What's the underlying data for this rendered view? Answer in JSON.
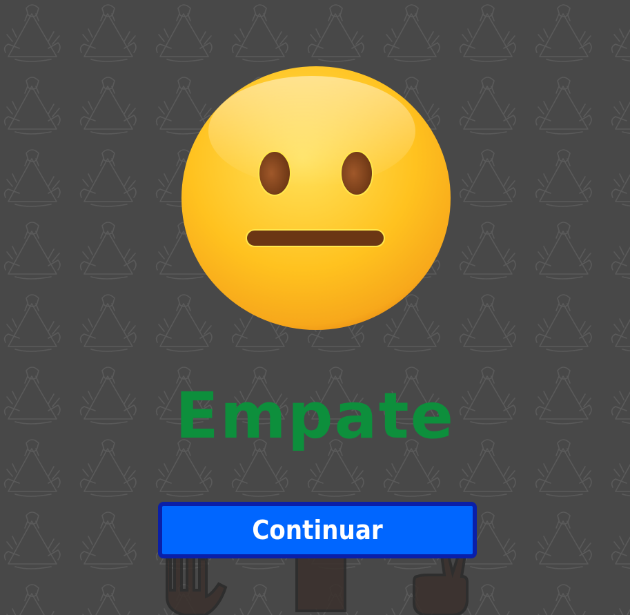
{
  "result": {
    "title": "Empate",
    "color": "#0d8f3c"
  },
  "emoji": {
    "icon": "neutral-face-icon"
  },
  "button": {
    "label": "Continuar",
    "color": "#0066ff",
    "border_color": "#0a1fa8"
  },
  "background": {
    "color": "#4f4f4f",
    "pattern_icon": "rock-paper-scissors-triangle-icon"
  },
  "choices": [
    {
      "icon": "paper-hand-icon"
    },
    {
      "icon": "rock-fist-icon"
    },
    {
      "icon": "scissors-hand-icon"
    }
  ]
}
